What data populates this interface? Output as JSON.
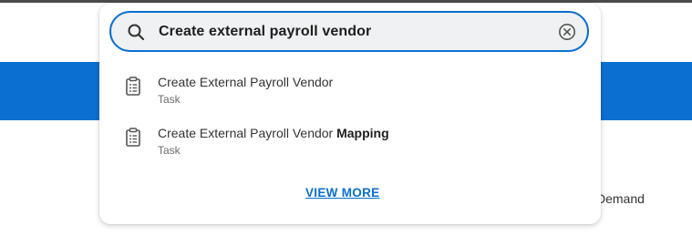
{
  "search": {
    "query": "Create external payroll vendor"
  },
  "results": [
    {
      "title": "Create External Payroll Vendor",
      "title_suffix": "",
      "kind": "Task"
    },
    {
      "title": "Create External Payroll Vendor ",
      "title_suffix": "Mapping",
      "kind": "Task"
    }
  ],
  "view_more_label": "VIEW MORE",
  "background": {
    "partial_text": "Demand"
  },
  "colors": {
    "accent": "#0a6fd1",
    "search_bg": "#f0f1f2"
  },
  "icons": {
    "search": "search-icon",
    "clear": "clear-icon",
    "result": "task-document-icon"
  }
}
